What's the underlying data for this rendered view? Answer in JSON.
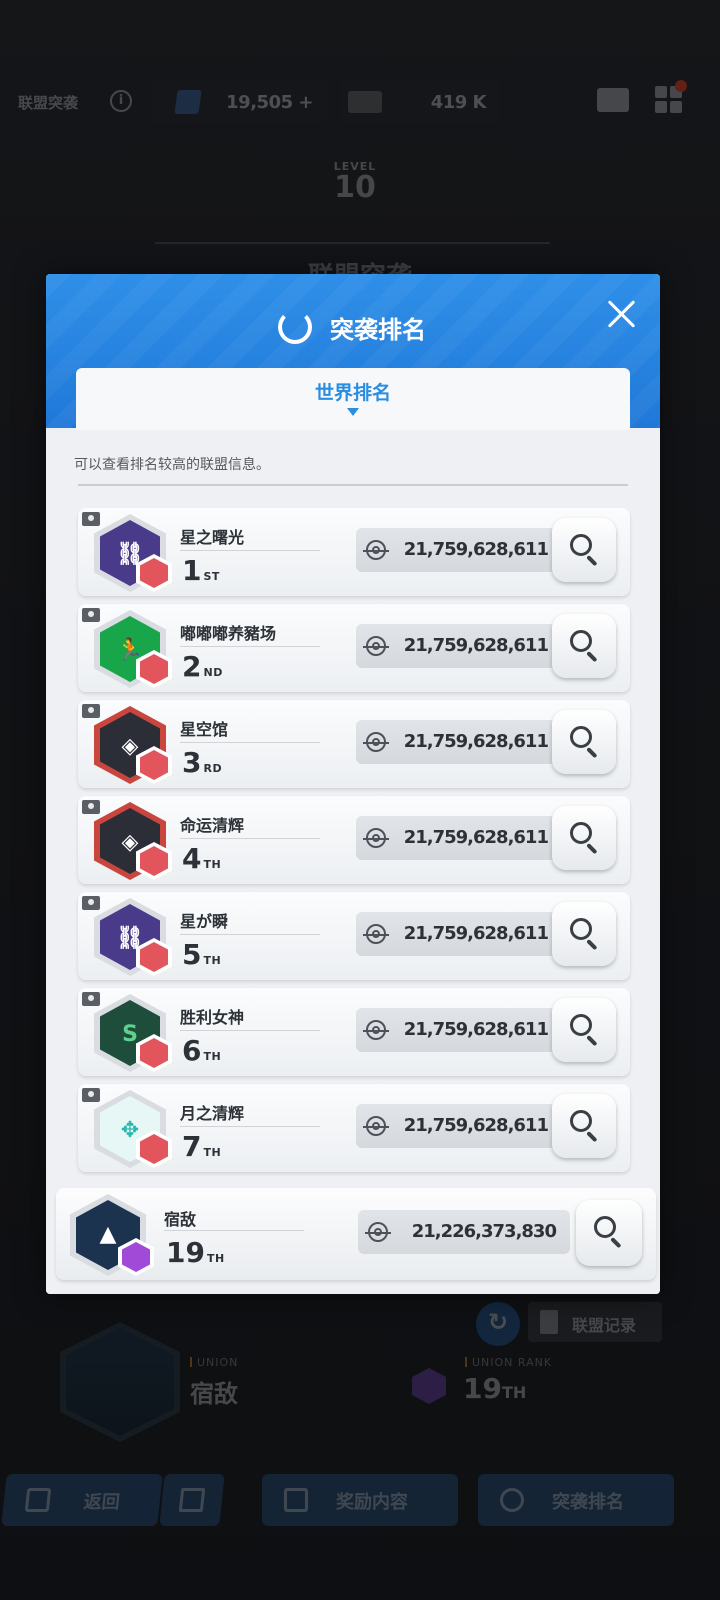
{
  "background": {
    "topbar_title": "联盟突袭",
    "info_glyph": "i",
    "resource_a": "19,505",
    "resource_a_plus": "+",
    "resource_b": "419 K",
    "level_word": "LEVEL",
    "level_num": "10",
    "hidden_title": "联盟突袭",
    "record_label": "联盟记录",
    "union_label": "UNION",
    "union_name": "宿敌",
    "union_rank_label": "UNION RANK",
    "union_rank": "19",
    "union_rank_suffix": "TH",
    "nav": {
      "back": "返回",
      "reward": "奖励内容",
      "rank": "突袭排名"
    }
  },
  "modal": {
    "title": "突袭排名",
    "tab": "世界排名",
    "hint": "可以查看排名较高的联盟信息。",
    "rows": [
      {
        "name": "星之曙光",
        "rank": "1",
        "suffix": "ST",
        "score": "21,759,628,611",
        "color": "#4a3a8a",
        "glyph": "⛓"
      },
      {
        "name": "嘟嘟嘟养豬场",
        "rank": "2",
        "suffix": "ND",
        "score": "21,759,628,611",
        "color": "#19a54a",
        "glyph": "🏃"
      },
      {
        "name": "星空馆",
        "rank": "3",
        "suffix": "RD",
        "score": "21,759,628,611",
        "color": "#2b2e36",
        "glyph": "◈"
      },
      {
        "name": "命运清辉",
        "rank": "4",
        "suffix": "TH",
        "score": "21,759,628,611",
        "color": "#2b2e36",
        "glyph": "◈"
      },
      {
        "name": "星が瞬",
        "rank": "5",
        "suffix": "TH",
        "score": "21,759,628,611",
        "color": "#4a3a8a",
        "glyph": "⛓"
      },
      {
        "name": "胜利女神",
        "rank": "6",
        "suffix": "TH",
        "score": "21,759,628,611",
        "color": "#1f4d3c",
        "glyph": "S"
      },
      {
        "name": "月之清辉",
        "rank": "7",
        "suffix": "TH",
        "score": "21,759,628,611",
        "color": "#e6f7f6",
        "glyph": "✥"
      }
    ],
    "my_row": {
      "name": "宿敌",
      "rank": "19",
      "suffix": "TH",
      "score": "21,226,373,830",
      "color": "#1c3350",
      "glyph": "▲"
    }
  }
}
